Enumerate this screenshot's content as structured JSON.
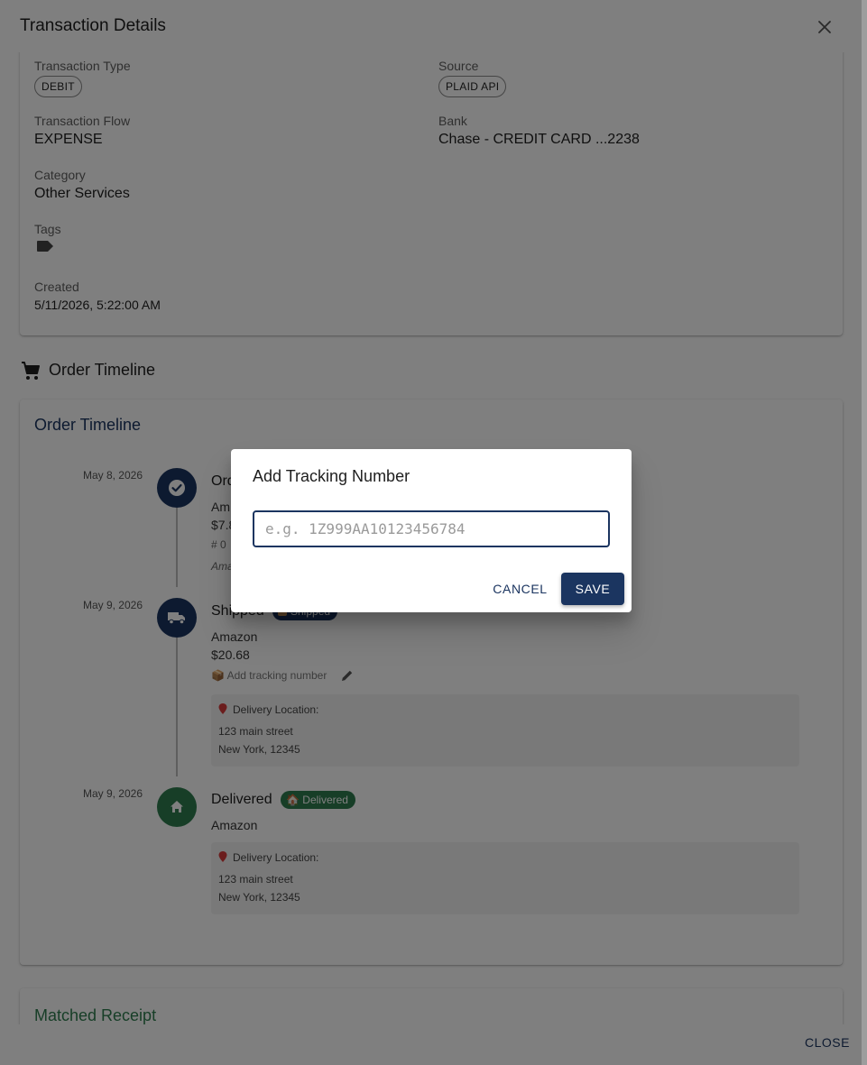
{
  "dialog": {
    "title": "Transaction Details",
    "close_label": "CLOSE"
  },
  "details": {
    "transaction_type_label": "Transaction Type",
    "transaction_type": "DEBIT",
    "source_label": "Source",
    "source": "PLAID API",
    "flow_label": "Transaction Flow",
    "flow": "EXPENSE",
    "bank_label": "Bank",
    "bank": "Chase - CREDIT CARD ...2238",
    "category_label": "Category",
    "category": "Other Services",
    "tags_label": "Tags",
    "created_label": "Created",
    "created": "5/11/2026, 5:22:00 AM"
  },
  "order_section": {
    "heading": "Order Timeline",
    "card_title": "Order Timeline",
    "events": [
      {
        "date": "May 8, 2026",
        "title": "Ord",
        "merchant": "Am",
        "amount": "$7.8",
        "order_ref": "# 0",
        "note": "Ama"
      },
      {
        "date": "May 9, 2026",
        "title": "Shipped",
        "badge": "Shipped",
        "merchant": "Amazon",
        "amount": "$20.68",
        "tracking_link": "📦 Add tracking number",
        "location_label": "Delivery Location:",
        "address_line1": "123 main street",
        "address_line2": "New York, 12345"
      },
      {
        "date": "May 9, 2026",
        "title": "Delivered",
        "badge": "🏠 Delivered",
        "merchant": "Amazon",
        "location_label": "Delivery Location:",
        "address_line1": "123 main street",
        "address_line2": "New York, 12345"
      }
    ]
  },
  "receipt": {
    "title": "Matched Receipt"
  },
  "modal": {
    "title": "Add Tracking Number",
    "input_placeholder": "e.g. 1Z999AA10123456784",
    "input_value": "",
    "cancel_label": "CANCEL",
    "save_label": "SAVE"
  },
  "colors": {
    "primary": "#1b3560",
    "success": "#2e7d4f",
    "scrim": "rgba(0,0,0,0.5)"
  },
  "icons": [
    "close-icon",
    "tag-icon",
    "cart-icon",
    "check-icon",
    "truck-icon",
    "home-icon",
    "edit-icon",
    "pin-icon"
  ]
}
